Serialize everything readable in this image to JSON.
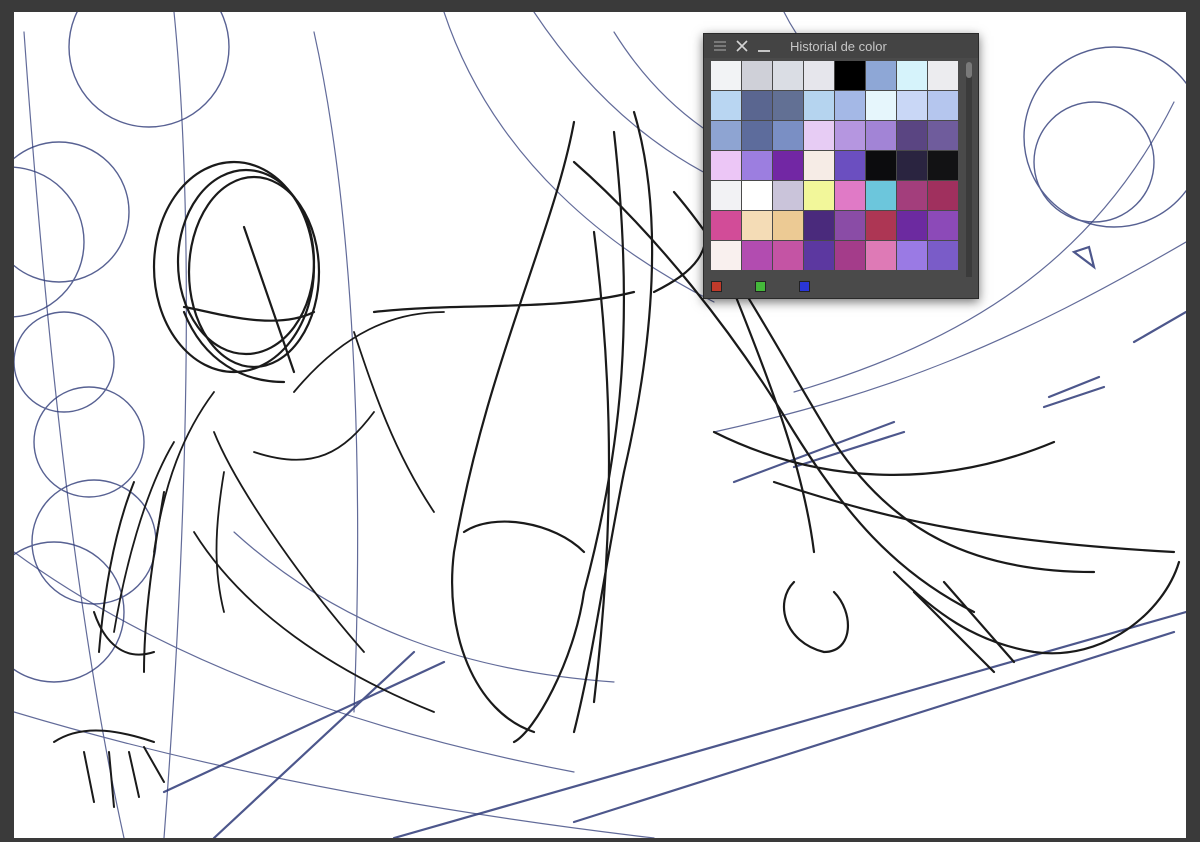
{
  "panel": {
    "title": "Historial de color",
    "icons": [
      "menu-icon",
      "close-icon",
      "minimize-icon"
    ],
    "swatches": [
      "#f2f3f5",
      "#cfd0d8",
      "#dadde4",
      "#e6e6ec",
      "#000000",
      "#8ea7d6",
      "#d6f3fb",
      "#ececef",
      "#b9d6f2",
      "#5a6690",
      "#627094",
      "#b5d4ef",
      "#a4b8e6",
      "#e6f6fc",
      "#c9d7f6",
      "#b5c6ee",
      "#8ea4d2",
      "#5d6c9c",
      "#7a8fc4",
      "#e7ccf4",
      "#b596e0",
      "#a284d6",
      "#5a4582",
      "#6f5c9c",
      "#ecc6f6",
      "#9c7ee0",
      "#7227a4",
      "#f6ece6",
      "#6b4fc0",
      "#0c0c0e",
      "#2a2440",
      "#121214",
      "#f2f2f4",
      "#ffffff",
      "#cac4da",
      "#f2f79a",
      "#e07ac6",
      "#6cc6dc",
      "#a33e7c",
      "#a0305e",
      "#d24c98",
      "#f4dcb6",
      "#ecca94",
      "#4a2a7c",
      "#8a4ca6",
      "#ad3654",
      "#6c2aa0",
      "#8c4ab8",
      "#f9f0ee",
      "#b24cb0",
      "#c454a4",
      "#5c38a0",
      "#a43c8a",
      "#de7ab6",
      "#9a7ae4",
      "#7a5cc8"
    ],
    "footer_chips": {
      "red": "#c03a2a",
      "green": "#44b83a",
      "blue": "#2a36d8"
    }
  },
  "colors": {
    "workspace_bg": "#3a3a3a",
    "canvas_bg": "#ffffff",
    "sketch_ink": "#1a1a1a",
    "guide_ink": "#2e3a78"
  }
}
